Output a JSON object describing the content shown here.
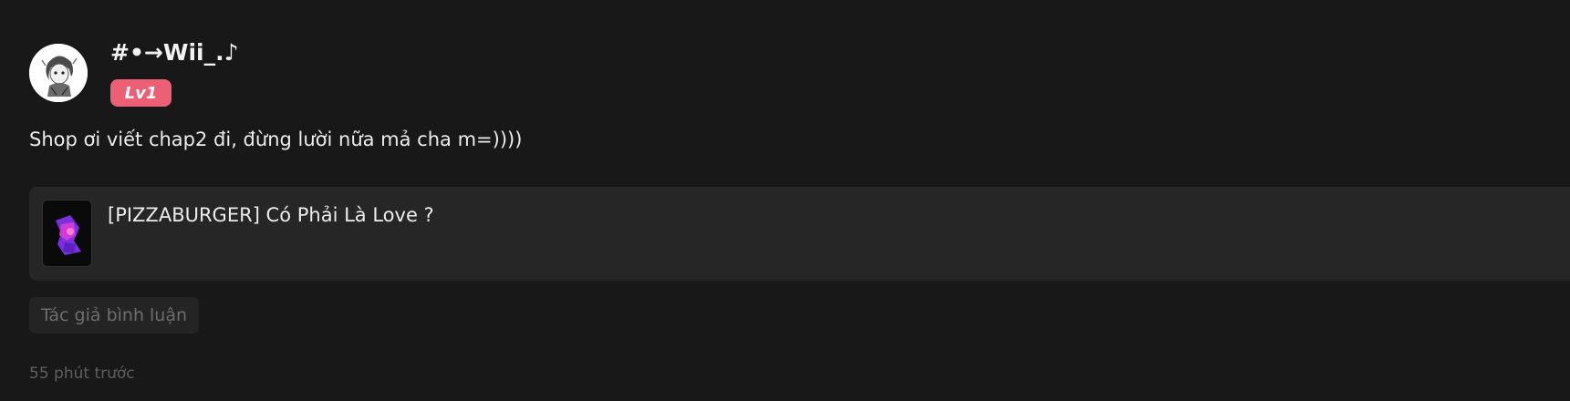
{
  "comment": {
    "username": "#•→Wii_.♪",
    "level": "Lv1",
    "text": "Shop ơi viết chap2 đi, đừng lười nữa mả cha m=))))",
    "story": {
      "title": "[PIZZABURGER] Có Phải Là Love ?",
      "thumbnail_icon": "cover-art-icon"
    },
    "author_tag": "Tác giả bình luận",
    "timestamp": "55 phút trước",
    "avatar_icon": "avatar-icon"
  },
  "colors": {
    "background": "#181818",
    "card": "#262626",
    "level_badge": "#ec5f74",
    "muted_text": "#5f5f5f"
  }
}
